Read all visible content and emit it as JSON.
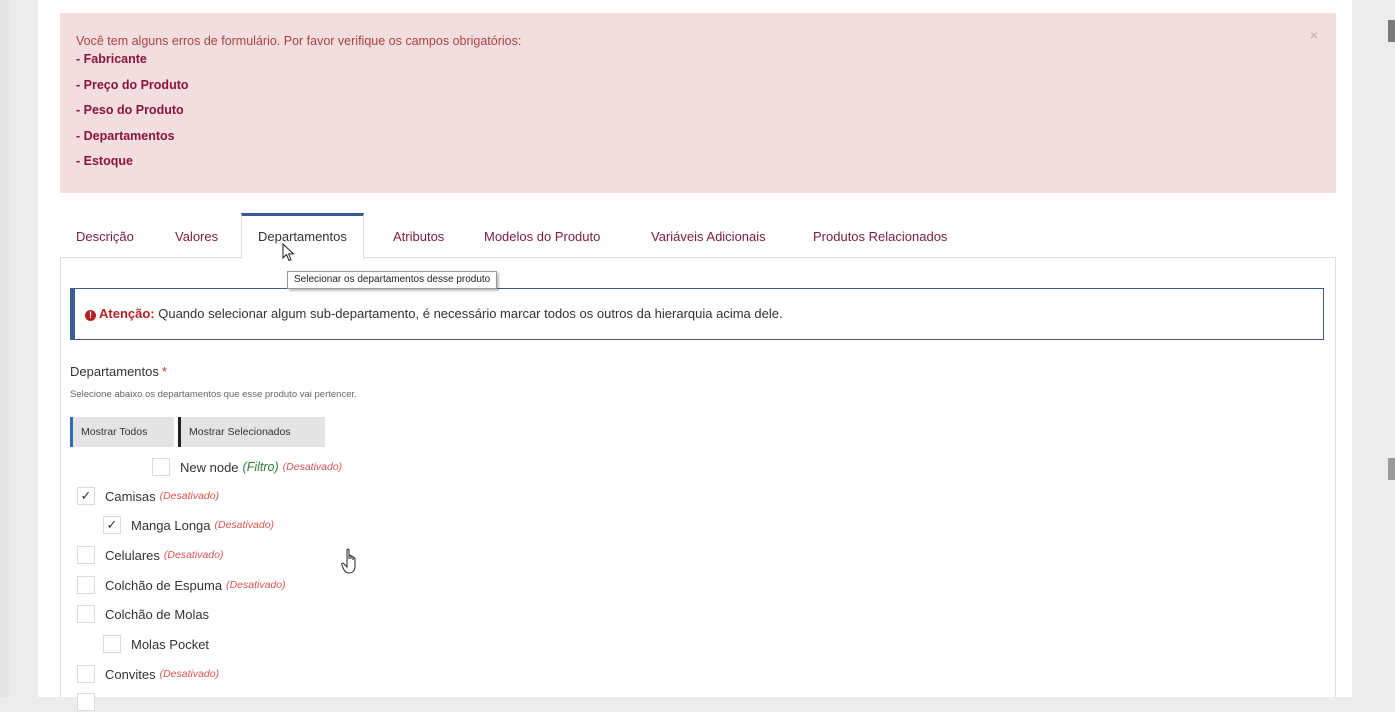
{
  "alert": {
    "intro": "Você tem alguns erros de formulário. Por favor verifique os campos obrigatórios:",
    "errors": [
      "- Fabricante",
      "- Preço do Produto",
      "- Peso do Produto",
      "- Departamentos",
      "- Estoque"
    ],
    "close": "×"
  },
  "tabs": [
    {
      "label": "Descrição"
    },
    {
      "label": "Valores"
    },
    {
      "label": "Departamentos",
      "active": true
    },
    {
      "label": "Atributos"
    },
    {
      "label": "Modelos do Produto"
    },
    {
      "label": "Variáveis Adicionais"
    },
    {
      "label": "Produtos Relacionados"
    }
  ],
  "tooltip": "Selecionar os departamentos desse produto",
  "attention": {
    "icon": "exclamation-circle-icon",
    "label": "Atenção:",
    "text": " Quando selecionar algum sub-departamento, é necessário marcar todos os outros da hierarquia acima dele."
  },
  "departments": {
    "title": "Departamentos",
    "required_mark": "*",
    "help": "Selecione abaixo os departamentos que esse produto vai pertencer.",
    "buttons": {
      "show_all": "Mostrar Todos",
      "show_selected": "Mostrar Selecionados"
    }
  },
  "tree": [
    {
      "label": "New node",
      "filter": "(Filtro)",
      "disabled": "(Desativado)",
      "checked": false,
      "level": 2
    },
    {
      "label": "Camisas",
      "disabled": "(Desativado)",
      "checked": true,
      "level": 0
    },
    {
      "label": "Manga Longa",
      "disabled": "(Desativado)",
      "checked": true,
      "level": 1
    },
    {
      "label": "Celulares",
      "disabled": "(Desativado)",
      "checked": false,
      "level": 0
    },
    {
      "label": "Colchão de Espuma",
      "disabled": "(Desativado)",
      "checked": false,
      "level": 0
    },
    {
      "label": "Colchão de Molas",
      "checked": false,
      "level": 0
    },
    {
      "label": "Molas Pocket",
      "checked": false,
      "level": 1
    },
    {
      "label": "Convites",
      "disabled": "(Desativado)",
      "checked": false,
      "level": 0
    }
  ],
  "check_glyph": "✓",
  "colors": {
    "alert_bg": "#f2dede",
    "alert_text": "#a94442",
    "accent_blue": "#3e5d96",
    "disabled_red": "#d9534f",
    "filter_green": "#2e7d32"
  }
}
